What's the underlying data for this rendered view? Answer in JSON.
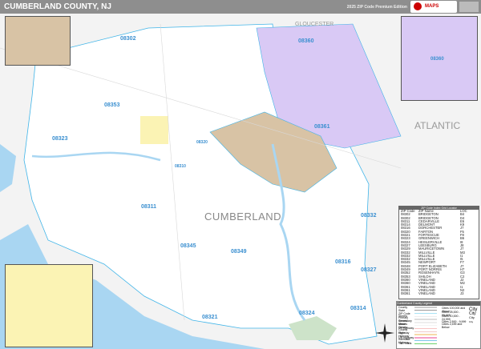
{
  "header": {
    "title": "CUMBERLAND COUNTY, NJ",
    "edition": "2025 ZIP Code Premium Edition"
  },
  "map_labels": {
    "county": "CUMBERLAND",
    "atlantic": "ATLANTIC",
    "gloucester": "GLOUCESTER",
    "zips": [
      "08302",
      "08353",
      "08360",
      "08361",
      "08323",
      "08311",
      "08345",
      "08349",
      "08321",
      "08324",
      "08314",
      "08327",
      "08316",
      "08332",
      "08320",
      "08310"
    ]
  },
  "colors": {
    "water": "#a9d6f2",
    "zip_purple": "#d9c9f5",
    "zip_tan": "#d8c3a5",
    "zip_yellow": "#fbf3b4",
    "zip_green": "#cde3c9",
    "zip_border": "#3fb4e8",
    "header": "#8e8e8e"
  },
  "zip_table": {
    "title": "ZIP Code Index Grid Locator",
    "headers": [
      "ZIP Code",
      "ZIP Name",
      "LOC"
    ],
    "rows": [
      [
        "08302",
        "BRIDGETON",
        "B4"
      ],
      [
        "08302",
        "BRIDGETON",
        "D4"
      ],
      [
        "08311",
        "CEDARVILLE",
        "E6"
      ],
      [
        "08314",
        "DELMONT",
        "K9"
      ],
      [
        "08316",
        "DORCHESTER",
        "J7"
      ],
      [
        "08320",
        "FAIRTON",
        "F5"
      ],
      [
        "08321",
        "FORTESCUE",
        "F8"
      ],
      [
        "08323",
        "GREENWICH",
        "B6"
      ],
      [
        "08324",
        "HEISLERVILLE",
        "I8"
      ],
      [
        "08327",
        "LEESBURG",
        "J8"
      ],
      [
        "08329",
        "MAURICETOWN",
        "J7"
      ],
      [
        "08332",
        "MILLVILLE",
        "M3"
      ],
      [
        "08332",
        "MILLVILLE",
        "I1"
      ],
      [
        "08332",
        "MILLVILLE",
        "I5"
      ],
      [
        "08345",
        "NEWPORT",
        "F7"
      ],
      [
        "08348",
        "PORT ELIZABETH",
        "J7"
      ],
      [
        "08349",
        "PORT NORRIS",
        "H7"
      ],
      [
        "08352",
        "ROSENHAYN",
        "G3"
      ],
      [
        "08353",
        "SHILOH",
        "C2"
      ],
      [
        "08360",
        "VINELAND",
        "J2"
      ],
      [
        "08360",
        "VINELAND",
        "M2"
      ],
      [
        "08361",
        "VINELAND",
        "I1"
      ],
      [
        "08361",
        "VINELAND",
        "N2"
      ],
      [
        "08361",
        "VINELAND",
        "J3"
      ]
    ]
  },
  "legend": {
    "title": "Cumberland County Legend",
    "items": [
      "County",
      "State",
      "ZIP Code",
      "Streets",
      "Primary Streets",
      "Secondary Streets",
      "Minor Streets",
      "US Highway",
      "County Highway",
      "State Highway",
      "US Highway",
      "Interstate Highway",
      "Toll Roads"
    ],
    "city_sizes": [
      "Cities 100,000 and Above",
      "Cities 25,000 - 99,999",
      "Cities 10,000 - 24,999",
      "Cities 2,500 - 9,999",
      "Cities 2,499 and Below"
    ],
    "city_samples": [
      "City",
      "City",
      "City",
      "City"
    ]
  }
}
